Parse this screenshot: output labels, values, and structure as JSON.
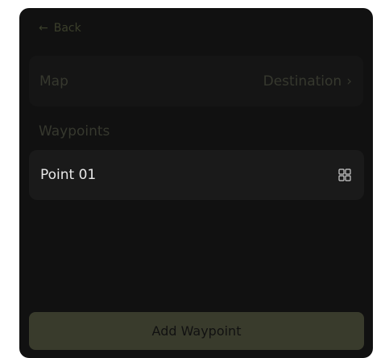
{
  "nav": {
    "back_arrow": "←",
    "back_label": "Back"
  },
  "map_row": {
    "label": "Map",
    "value": "Destination",
    "chevron": "›"
  },
  "waypoints": {
    "section_title": "Waypoints",
    "items": [
      {
        "label": "Point 01",
        "icon": "grid-icon"
      }
    ]
  },
  "actions": {
    "add_label": "Add Waypoint"
  },
  "colors": {
    "panel_bg": "#111111",
    "row_bg": "#1a1a1a",
    "muted_text": "#36382e",
    "accent_button": "#393b2c"
  }
}
